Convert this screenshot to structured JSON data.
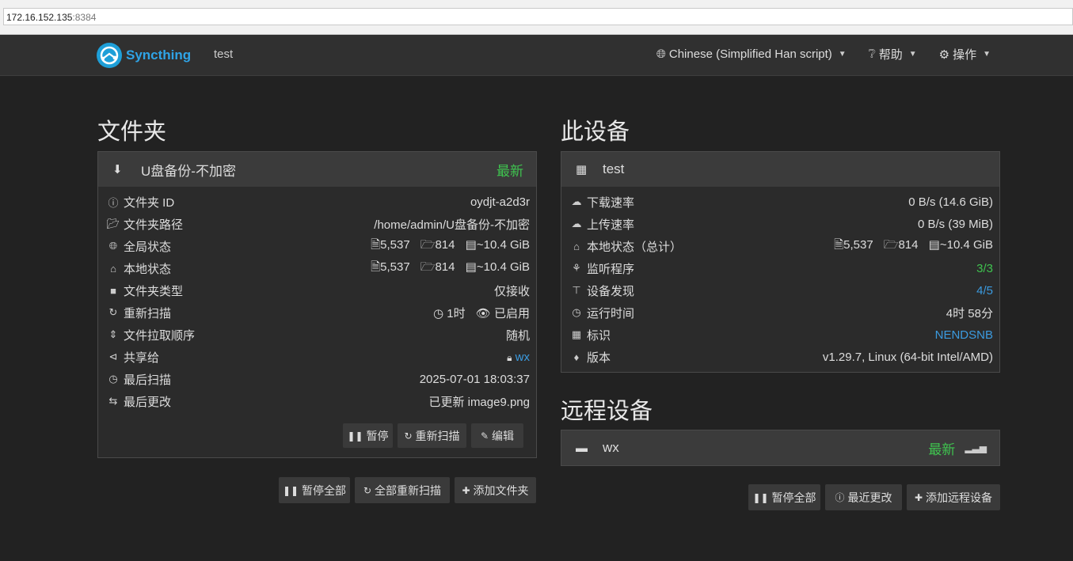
{
  "browser": {
    "host": "172.16.152.135",
    "port": ":8384"
  },
  "navbar": {
    "brand": "Syncthing",
    "device_name": "test",
    "language": "Chinese (Simplified Han script)",
    "help": "帮助",
    "actions": "操作"
  },
  "folders": {
    "heading": "文件夹",
    "folder": {
      "name": "U盘备份-不加密",
      "status": "最新",
      "rows": {
        "id": {
          "label": "文件夹 ID",
          "value": "oydjt-a2d3r"
        },
        "path": {
          "label": "文件夹路径",
          "value": "/home/admin/U盘备份-不加密"
        },
        "global": {
          "label": "全局状态",
          "files": "5,537",
          "dirs": "814",
          "size": "~10.4 GiB"
        },
        "local": {
          "label": "本地状态",
          "files": "5,537",
          "dirs": "814",
          "size": "~10.4 GiB"
        },
        "type": {
          "label": "文件夹类型",
          "value": "仅接收"
        },
        "rescan": {
          "label": "重新扫描",
          "interval": "1时",
          "watch": "已启用"
        },
        "order": {
          "label": "文件拉取顺序",
          "value": "随机"
        },
        "shared": {
          "label": "共享给",
          "value": "wx"
        },
        "last_scan": {
          "label": "最后扫描",
          "value": "2025-07-01 18:03:37"
        },
        "last_change": {
          "label": "最后更改",
          "value": "已更新 image9.png"
        }
      },
      "buttons": {
        "pause": "暂停",
        "rescan": "重新扫描",
        "edit": "编辑"
      }
    },
    "buttons": {
      "pause_all": "暂停全部",
      "rescan_all": "全部重新扫描",
      "add_folder": "添加文件夹"
    }
  },
  "this_device": {
    "heading": "此设备",
    "name": "test",
    "rows": {
      "download": {
        "label": "下载速率",
        "value": "0 B/s (14.6 GiB)"
      },
      "upload": {
        "label": "上传速率",
        "value": "0 B/s (39 MiB)"
      },
      "local_total": {
        "label": "本地状态（总计）",
        "files": "5,537",
        "dirs": "814",
        "size": "~10.4 GiB"
      },
      "listeners": {
        "label": "监听程序",
        "value": "3/3"
      },
      "discovery": {
        "label": "设备发现",
        "value": "4/5"
      },
      "uptime": {
        "label": "运行时间",
        "value": "4时 58分"
      },
      "identity": {
        "label": "标识",
        "value": "NENDSNB"
      },
      "version": {
        "label": "版本",
        "value": "v1.29.7, Linux (64-bit Intel/AMD)"
      }
    }
  },
  "remote_devices": {
    "heading": "远程设备",
    "device": {
      "name": "wx",
      "status": "最新"
    },
    "buttons": {
      "pause_all": "暂停全部",
      "recent_changes": "最近更改",
      "add_device": "添加远程设备"
    }
  },
  "colors": {
    "accent": "#2fa4e7",
    "ok": "#3fc34f",
    "link": "#3b9be0",
    "background": "#222222",
    "panel": "#2b2b2b"
  }
}
